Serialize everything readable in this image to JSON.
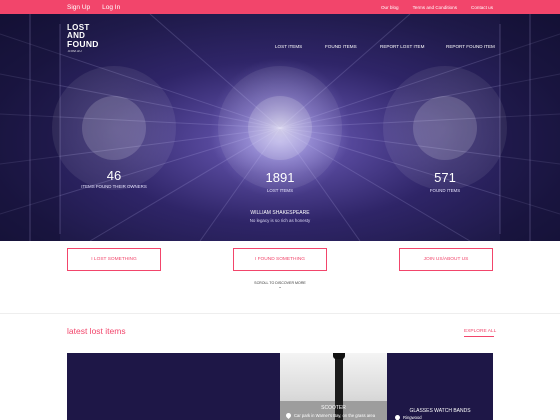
{
  "topbar": {
    "signup": "Sign Up",
    "login": "Log In",
    "blog": "Our blog",
    "terms": "Terms and Conditions",
    "contact": "Contact us"
  },
  "logo": {
    "line1": "LOST AND",
    "line2": "FOUND",
    "sub": ".COM.AU"
  },
  "nav": {
    "lost_items": "LOST ITEMS",
    "found_items": "FOUND ITEMS",
    "report_lost": "REPORT LOST ITEM",
    "report_found": "REPORT FOUND ITEM"
  },
  "stats": [
    {
      "value": "46",
      "label": "ITEMS FOUND THEIR OWNERS"
    },
    {
      "value": "1891",
      "label": "LOST ITEMS"
    },
    {
      "value": "571",
      "label": "FOUND ITEMS"
    }
  ],
  "quote": {
    "author": "WILLIAM SHAKESPEARE",
    "text": "No legacy is so rich as honesty"
  },
  "cta": {
    "lost": "I LOST SOMETHING",
    "found": "I FOUND SOMETHING",
    "join": "JOIN US/ABOUT US"
  },
  "scroll_hint": "SCROLL TO DISCOVER MORE",
  "latest": {
    "title": "latest lost items",
    "explore": "EXPLORE ALL"
  },
  "items": [
    {
      "title": "",
      "location": ""
    },
    {
      "title": "SCOOTER",
      "location": "Car park in Warner's Bay, on the grass area"
    },
    {
      "title": "GLASSES WATCH BANDS",
      "location": "Ringwood"
    }
  ],
  "colors": {
    "accent": "#f2456b",
    "hero_dark": "#1f1a4a",
    "hero_light": "#8a7fd0"
  }
}
